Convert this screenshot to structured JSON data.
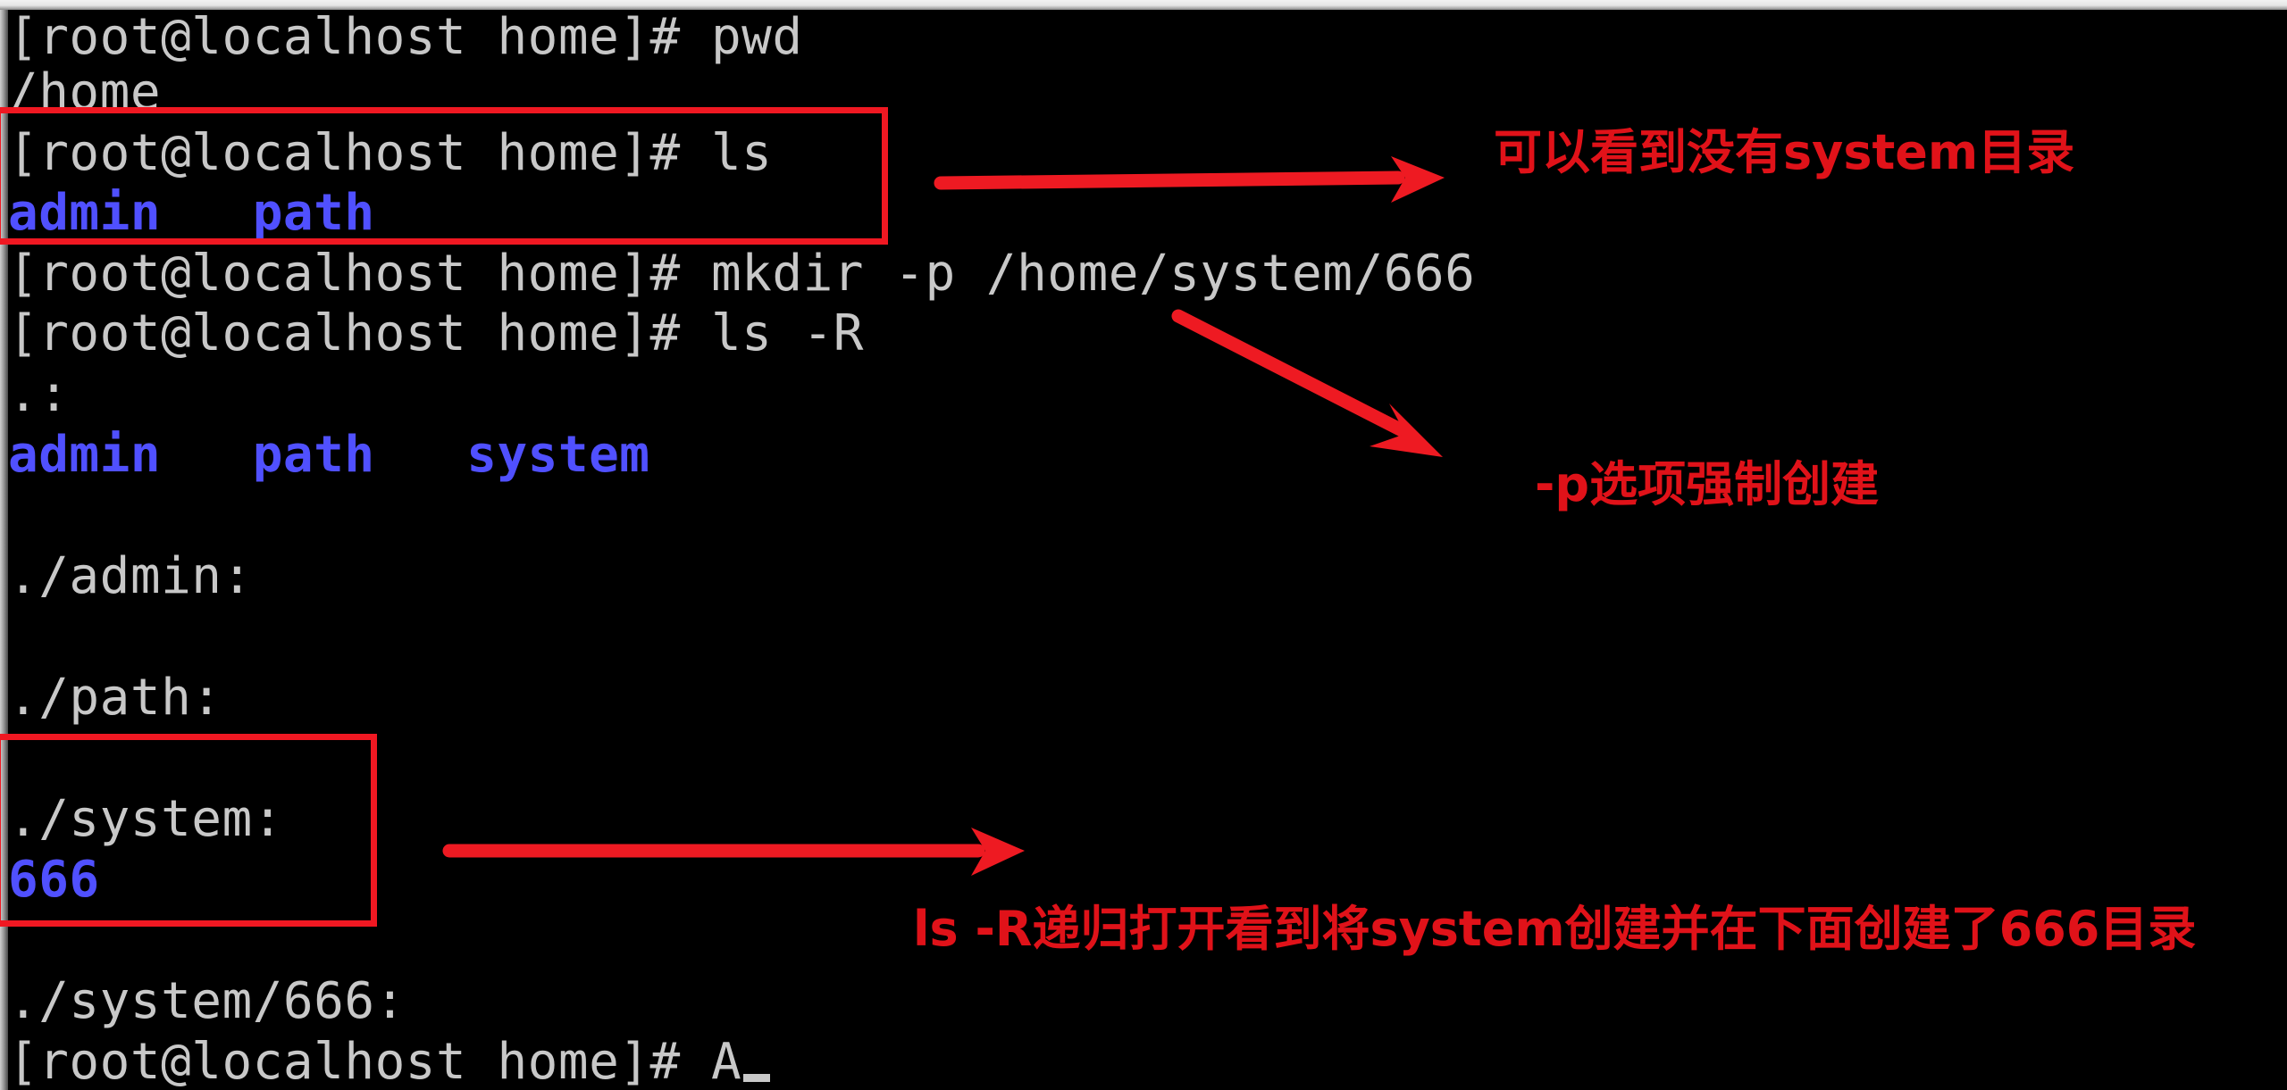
{
  "window": {
    "title_bar_color": "#e8e8e8",
    "terminal_bg": "#000000",
    "text_color": "#c8c8c8",
    "dir_color": "#5050ff",
    "annotation_color": "#e01219"
  },
  "terminal": {
    "prompt": "[root@localhost home]#",
    "lines": [
      {
        "text": "[root@localhost home]# pwd",
        "kind": "prompt"
      },
      {
        "text": "/home",
        "kind": "output"
      },
      {
        "text": "[root@localhost home]# ls",
        "kind": "prompt"
      },
      {
        "text": "admin   path",
        "kind": "dir"
      },
      {
        "text": "[root@localhost home]# mkdir -p /home/system/666",
        "kind": "prompt"
      },
      {
        "text": "[root@localhost home]# ls -R",
        "kind": "prompt"
      },
      {
        "text": ".:",
        "kind": "output"
      },
      {
        "text": "admin   path   system",
        "kind": "dir"
      },
      {
        "text": "",
        "kind": "output"
      },
      {
        "text": "./admin:",
        "kind": "output"
      },
      {
        "text": "",
        "kind": "output"
      },
      {
        "text": "./path:",
        "kind": "output"
      },
      {
        "text": "",
        "kind": "output"
      },
      {
        "text": "./system:",
        "kind": "output"
      },
      {
        "text": "666",
        "kind": "dir"
      },
      {
        "text": "",
        "kind": "output"
      },
      {
        "text": "./system/666:",
        "kind": "output"
      },
      {
        "text": "[root@localhost home]# A",
        "kind": "prompt-cursor"
      }
    ]
  },
  "annotations": {
    "notes": [
      {
        "id": "note-no-system-dir",
        "text": "可以看到没有system目录"
      },
      {
        "id": "note-p-option",
        "text": "-p选项强制创建"
      },
      {
        "id": "note-ls-recursive",
        "text": "ls -R递归打开看到将system创建并在下面创建了666目录"
      }
    ],
    "boxes": [
      {
        "id": "highlight-box-ls-output"
      },
      {
        "id": "highlight-box-system-666"
      }
    ],
    "arrows": [
      {
        "id": "arrow-to-no-system-note"
      },
      {
        "id": "arrow-to-p-option-note"
      },
      {
        "id": "arrow-to-ls-recursive-note"
      }
    ]
  }
}
